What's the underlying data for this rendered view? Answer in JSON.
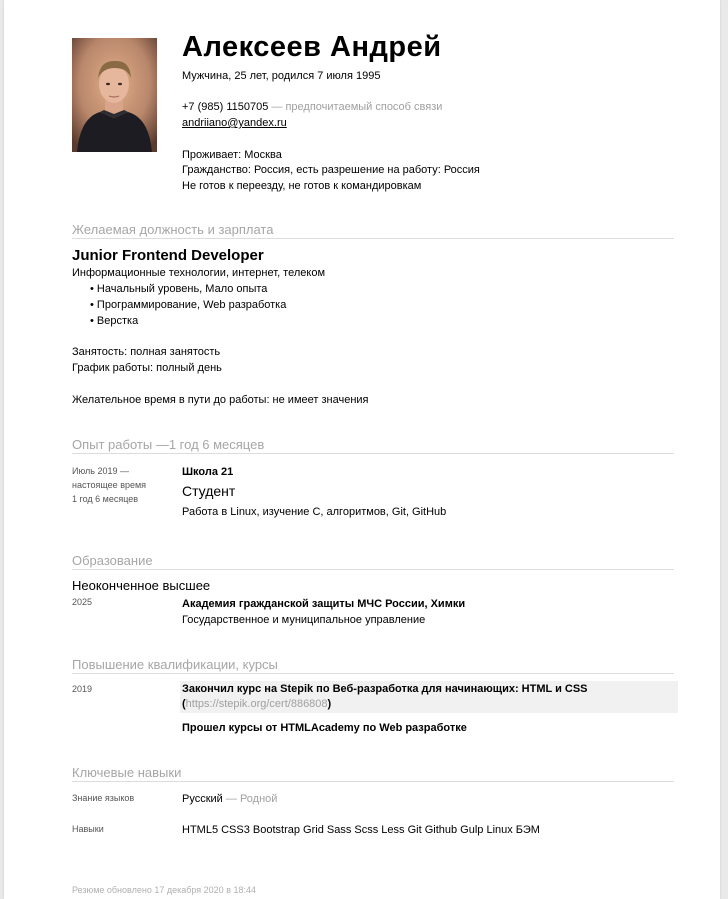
{
  "header": {
    "name": "Алексеев Андрей",
    "bio": "Мужчина, 25 лет, родился 7 июля 1995",
    "phone": "+7 (985) 1150705",
    "phone_note": "— предпочитаемый способ связи",
    "email": "andriiano@yandex.ru",
    "residence": "Проживает: Москва",
    "citizenship": "Гражданство: Россия, есть разрешение на работу: Россия",
    "relocation": "Не готов к переезду, не готов к командировкам"
  },
  "position": {
    "section_title": "Желаемая должность и зарплата",
    "title": "Junior Frontend Developer",
    "industry": "Информационные технологии, интернет, телеком",
    "specializations": [
      "Начальный уровень, Мало опыта",
      "Программирование, Web разработка",
      "Верстка"
    ],
    "employment": "Занятость: полная занятость",
    "schedule": "График работы: полный день",
    "commute": "Желательное время в пути до работы: не имеет значения"
  },
  "experience": {
    "section_title": "Опыт работы —1 год 6 месяцев",
    "period_line1": "Июль 2019 —",
    "period_line2": "настоящее время",
    "duration": "1 год 6 месяцев",
    "company": "Школа 21",
    "role": "Студент",
    "description": "Работа в Linux, изучение C, алгоритмов, Git, GitHub"
  },
  "education": {
    "section_title": "Образование",
    "level": "Неоконченное высшее",
    "year": "2025",
    "institution": "Академия гражданской защиты МЧС России, Химки",
    "faculty": "Государственное и муниципальное управление"
  },
  "courses": {
    "section_title": "Повышение квалификации, курсы",
    "year": "2019",
    "course1_text": "Закончил курс на Stepik по Веб-разработка для начинающих: HTML и CSS",
    "course1_open": "(",
    "course1_link": "https://stepik.org/cert/886808",
    "course1_close": ")",
    "course2_text": "Прошел курсы от HTMLAcademy по Web разработке"
  },
  "skills": {
    "section_title": "Ключевые навыки",
    "languages_label": "Знание языков",
    "language": "Русский",
    "language_level": "— Родной",
    "skills_label": "Навыки",
    "skills_list": "HTML5 CSS3 Bootstrap Grid Sass Scss Less Git Github Gulp Linux БЭМ"
  },
  "footer": {
    "updated": "Резюме обновлено 17 декабря 2020 в 18:44"
  }
}
